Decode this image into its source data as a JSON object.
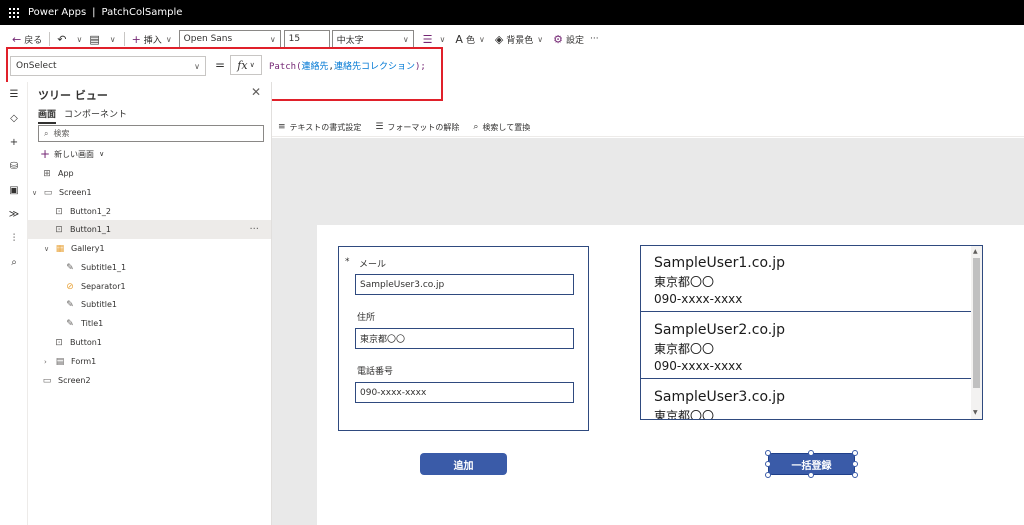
{
  "app": {
    "product": "Power Apps",
    "separator": "|",
    "name": "PatchColSample"
  },
  "toolbar": {
    "back_label": "戻る",
    "insert_label": "挿入",
    "font_value": "Open Sans",
    "size_value": "15",
    "weight_value": "中太字",
    "color_label": "色",
    "bg_label": "背景色",
    "settings_label": "設定",
    "more_label": "···"
  },
  "formula_bar": {
    "property": "OnSelect",
    "equals": "=",
    "fx_label": "fx",
    "formula_fn": "Patch(",
    "formula_arg1": "連絡先",
    "formula_comma": ",",
    "formula_arg2": "連絡先コレクション",
    "formula_end": ");"
  },
  "tree_view": {
    "title": "ツリー ビュー",
    "tabs": [
      "画面",
      "コンポーネント"
    ],
    "search_placeholder": "検索",
    "new_screen_label": "新しい画面",
    "items": [
      {
        "label": "App",
        "icon": "app-icon"
      },
      {
        "label": "Screen1",
        "icon": "screen-icon"
      },
      {
        "label": "Button1_2",
        "icon": "button-icon"
      },
      {
        "label": "Button1_1",
        "icon": "button-icon"
      },
      {
        "label": "Gallery1",
        "icon": "gallery-icon"
      },
      {
        "label": "Subtitle1_1",
        "icon": "label-icon"
      },
      {
        "label": "Separator1",
        "icon": "separator-icon"
      },
      {
        "label": "Subtitle1",
        "icon": "label-icon"
      },
      {
        "label": "Title1",
        "icon": "label-icon"
      },
      {
        "label": "Button1",
        "icon": "button-icon"
      },
      {
        "label": "Form1",
        "icon": "form-icon"
      },
      {
        "label": "Screen2",
        "icon": "screen-icon"
      }
    ],
    "more_label": "···"
  },
  "text_ribbon": {
    "format_text": "テキストの書式設定",
    "remove_format": "フォーマットの解除",
    "find_replace": "検索して置換"
  },
  "form": {
    "required_mark": "*",
    "email_label": "メール",
    "email_value": "SampleUser3.co.jp",
    "address_label": "住所",
    "address_value": "東京都〇〇",
    "phone_label": "電話番号",
    "phone_value": "090-xxxx-xxxx"
  },
  "gallery": {
    "items": [
      {
        "title": "SampleUser1.co.jp",
        "address": "東京都〇〇",
        "phone": "090-xxxx-xxxx"
      },
      {
        "title": "SampleUser2.co.jp",
        "address": "東京都〇〇",
        "phone": "090-xxxx-xxxx"
      },
      {
        "title": "SampleUser3.co.jp",
        "address": "東京都〇〇",
        "phone": ""
      }
    ]
  },
  "buttons": {
    "add_label": "追加",
    "bulk_label": "一括登録"
  },
  "colors": {
    "accent": "#742774",
    "button": "#3a5ba8",
    "border": "#2f4a7f",
    "highlight": "#e0202a"
  }
}
